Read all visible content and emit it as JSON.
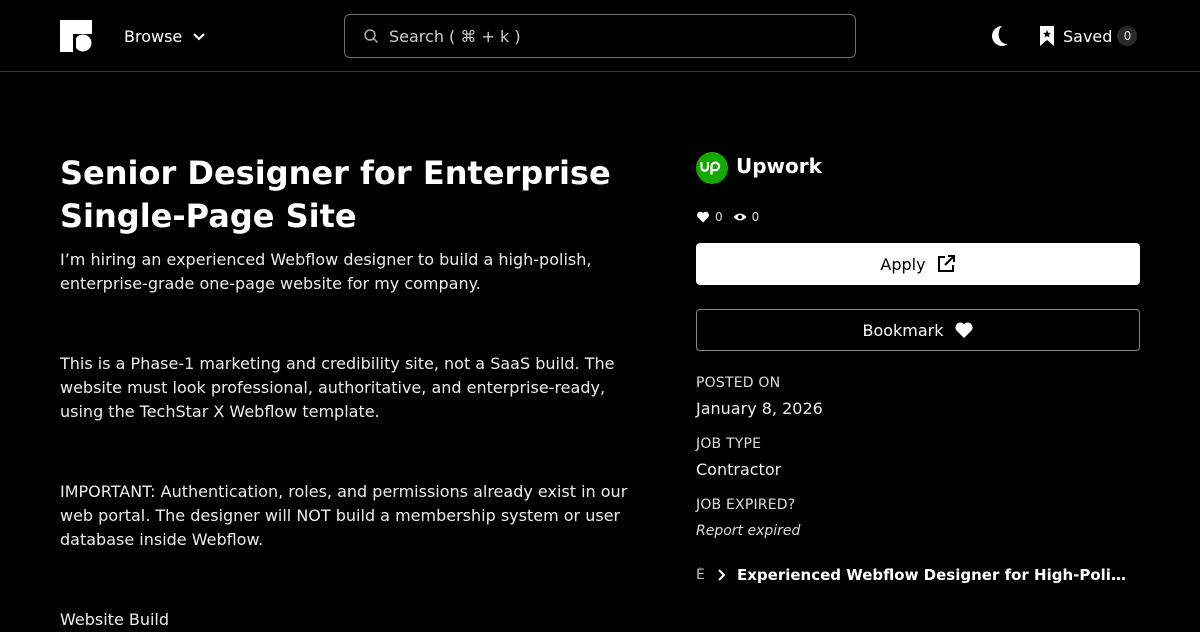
{
  "nav": {
    "browse_label": "Browse",
    "search_placeholder": "Search ( ⌘ + k )",
    "saved_label": "Saved",
    "saved_count": "0"
  },
  "job": {
    "title": "Senior Designer for Enterprise Single-Page Site",
    "paragraphs": [
      "I’m hiring an experienced Webflow designer to build a high-polish, enterprise-grade one-page website for my company.",
      "This is a Phase-1 marketing and credibility site, not a SaaS build. The website must look professional, authoritative, and enterprise-ready, using the TechStar X Webflow template.",
      "IMPORTANT: Authentication, roles, and permissions already exist in our web portal. The designer will NOT build a membership system or user database inside Webflow.",
      "Website Build"
    ]
  },
  "sidebar": {
    "company_name": "Upwork",
    "likes": "0",
    "views": "0",
    "apply_label": "Apply",
    "bookmark_label": "Bookmark",
    "posted_on_label": "POSTED ON",
    "posted_on_value": "January 8, 2026",
    "job_type_label": "JOB TYPE",
    "job_type_value": "Contractor",
    "expired_label": "JOB EXPIRED?",
    "report_label": "Report expired",
    "related_prefix": "É",
    "related_title": "Experienced Webflow Designer for High-Polish Enterprise Site"
  },
  "colors": {
    "background": "#000000",
    "brand_green": "#14a800"
  }
}
